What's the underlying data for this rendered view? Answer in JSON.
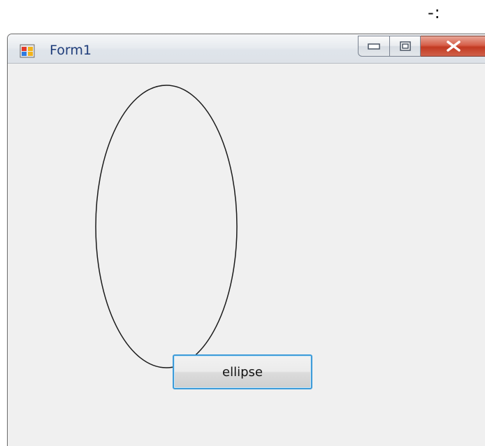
{
  "corner_text": "-:",
  "window": {
    "title": "Form1",
    "icon": "form-app-icon",
    "controls": {
      "minimize": "minimize-icon",
      "maximize": "maximize-icon",
      "close": "close-icon"
    }
  },
  "content": {
    "button_label": "ellipse",
    "shape": "ellipse"
  },
  "colors": {
    "title_text": "#1f3d7a",
    "client_background": "#f0f0f0",
    "button_border": "#3d9bd9",
    "close_button": "#c23a22",
    "ellipse_stroke": "#1a1a1a"
  }
}
